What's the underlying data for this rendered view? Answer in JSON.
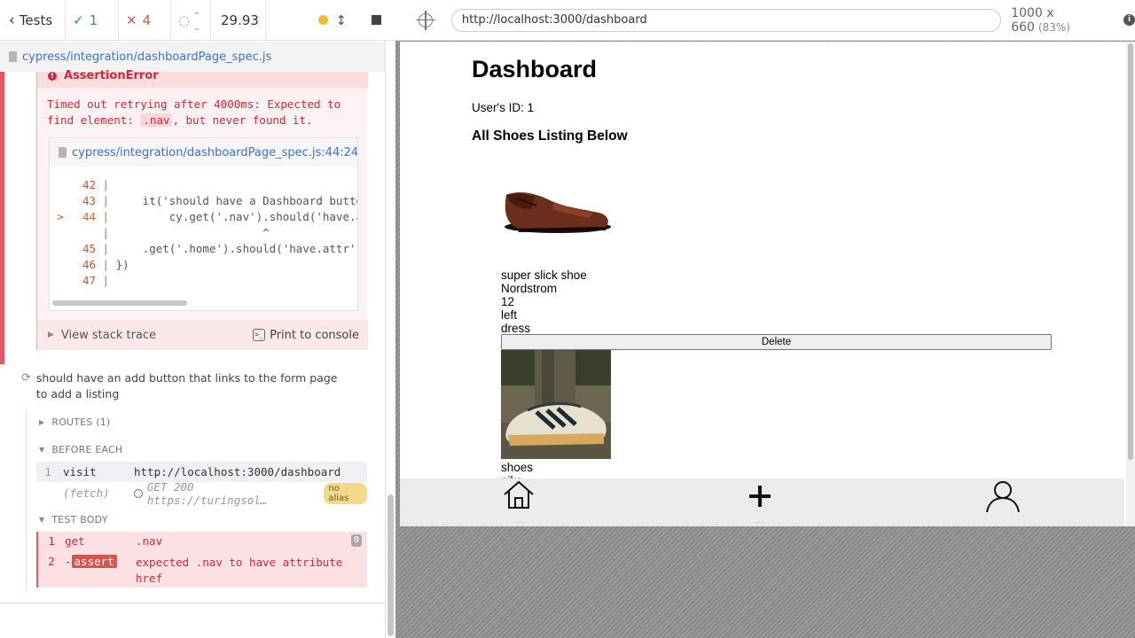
{
  "reporter": {
    "tests_label": "Tests",
    "passed": "1",
    "failed": "4",
    "pending": "--",
    "duration": "29.93",
    "spec_path": "cypress/integration/dashboardPage_spec.js"
  },
  "error": {
    "title": "AssertionError",
    "msg_part1": "Timed out retrying after 4000ms: Expected to find element: ",
    "msg_code": ".nav",
    "msg_part2": ", but never found it.",
    "code_file": "cypress/integration/dashboardPage_spec.js:44:24",
    "code_lines": [
      {
        "n": "42",
        "marker": "",
        "code": ""
      },
      {
        "n": "43",
        "marker": "",
        "code": "    it('should have a Dashboard butto"
      },
      {
        "n": "44",
        "marker": ">",
        "code": "        cy.get('.nav').should('have.a"
      },
      {
        "n": "",
        "marker": "",
        "code": "                      ^"
      },
      {
        "n": "45",
        "marker": "",
        "code": "    .get('.home').should('have.attr',"
      },
      {
        "n": "46",
        "marker": "",
        "code": "})"
      },
      {
        "n": "47",
        "marker": "",
        "code": ""
      }
    ],
    "view_stack": "View stack trace",
    "print_console": "Print to console"
  },
  "test": {
    "title": "should have an add button that links to the form page to add a listing",
    "routes": "ROUTES (1)",
    "before_each": "BEFORE EACH",
    "test_body": "TEST BODY",
    "before_cmds": [
      {
        "num": "1",
        "name": "visit",
        "msg": "http://localhost:3000/dashboard"
      },
      {
        "num": "",
        "name": "(fetch)",
        "msg": "GET 200 https://turingsol…",
        "badge": "no alias"
      }
    ],
    "body_cmds": [
      {
        "num": "1",
        "name": "get",
        "msg": ".nav",
        "count": "0"
      },
      {
        "num": "2",
        "name": "assert",
        "msg1": "expected",
        "msg_code": ".nav",
        "msg2": "to have attribute",
        "msg3": "href"
      }
    ]
  },
  "runner": {
    "url": "http://localhost:3000/dashboard",
    "viewport": "1000 x 660",
    "scale": "(83%)"
  },
  "app": {
    "title": "Dashboard",
    "user_id": "User's ID: 1",
    "listing_heading": "All Shoes Listing Below",
    "shoe1": {
      "name": "super slick shoe",
      "brand": "Nordstrom",
      "size": "12",
      "side": "left",
      "type": "dress"
    },
    "delete_label": "Delete",
    "shoe2": {
      "name": "shoes",
      "brand": "nike"
    }
  }
}
